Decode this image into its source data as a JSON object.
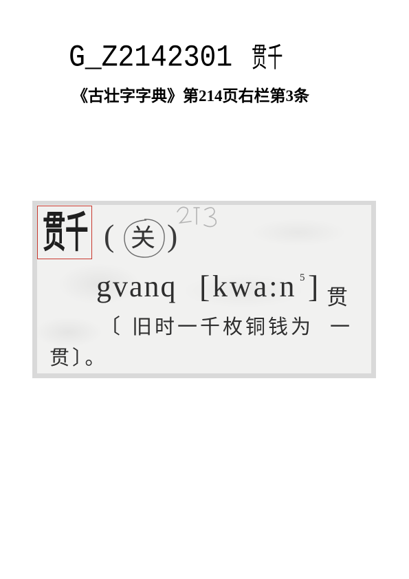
{
  "header": {
    "code": "G_Z2142301",
    "glyph_parts": [
      "贯",
      "千"
    ]
  },
  "source_line": "《古壮字字典》第214页右栏第3条",
  "entry": {
    "headword_parts": [
      "贯",
      "千"
    ],
    "variant_open": "(",
    "variant": "关",
    "variant_close": ")",
    "romanization": "gvanq",
    "ipa_open": "[",
    "ipa": "kwa:n",
    "ipa_tone": "5",
    "ipa_close": "]",
    "gloss": "贯",
    "def_open": "〔",
    "definition": "旧时一千枚铜钱为",
    "definition_line1_end": "一",
    "definition_line2": "贯〕。"
  },
  "colors": {
    "highlight_box": "#c8372d",
    "scan_border": "#d9d9d9",
    "scan_paper": "#f1f1f0"
  }
}
